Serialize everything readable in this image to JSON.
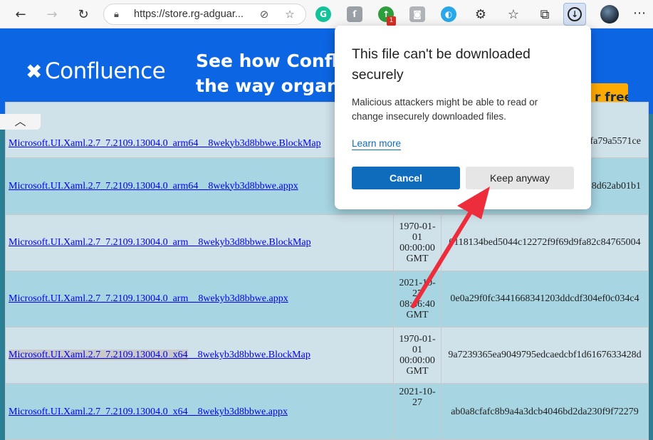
{
  "browser": {
    "url": "https://store.rg-adguar...",
    "back_icon": "arrow-left",
    "forward_icon": "arrow-right",
    "refresh_icon": "refresh",
    "lock_icon": "lock",
    "ext_badge": "1"
  },
  "banner": {
    "logo_text": "Confluence",
    "headline_line1": "See how Conflue",
    "headline_line2": "the way organiza",
    "cta_label": "r free"
  },
  "table": {
    "rows": [
      {
        "file": "Microsoft.UI.Xaml.2.7_7.2109.13004.0_arm64__8wekyb3d8bbwe.BlockMap",
        "date": [
          "",
          "",
          "",
          ""
        ],
        "hash": "fa79a5571ce"
      },
      {
        "file": "Microsoft.UI.Xaml.2.7_7.2109.13004.0_arm64__8wekyb3d8bbwe.appx",
        "date": [
          "",
          "",
          "",
          ""
        ],
        "hash": "8d62ab01b1"
      },
      {
        "file": "Microsoft.UI.Xaml.2.7_7.2109.13004.0_arm__8wekyb3d8bbwe.BlockMap",
        "date": [
          "1970-01-",
          "01",
          "00:00:00",
          "GMT"
        ],
        "hash": "0118134bed5044c12272f9f69d9fa82c84765004"
      },
      {
        "file": "Microsoft.UI.Xaml.2.7_7.2109.13004.0_arm__8wekyb3d8bbwe.appx",
        "date": [
          "2021-10-",
          "27",
          "08:46:40",
          "GMT"
        ],
        "hash": "0e0a29f0fc3441668341203ddcdf304ef0c034c4"
      },
      {
        "file_hl": "Microsoft.UI.Xaml.2.7_7.2109.13004.0_x64",
        "file_rest": "__8wekyb3d8bbwe.BlockMap",
        "date": [
          "1970-01-",
          "01",
          "00:00:00",
          "GMT"
        ],
        "hash": "9a7239365ea9049795edcaedcbf1d6167633428d"
      },
      {
        "file": "Microsoft.UI.Xaml.2.7_7.2109.13004.0_x64__8wekyb3d8bbwe.appx",
        "date": [
          "2021-10-",
          "27",
          "",
          ""
        ],
        "hash": "ab0a8cfafc8b9a4a3dcb4046bd2da230f9f72279"
      }
    ]
  },
  "dialog": {
    "title": "This file can't be downloaded securely",
    "message": "Malicious attackers might be able to read or change insecurely downloaded files.",
    "learn_more": "Learn more",
    "cancel_label": "Cancel",
    "keep_label": "Keep anyway"
  },
  "colors": {
    "banner_bg": "#0c66e4",
    "primary_button": "#0f6cbd",
    "annotation_arrow": "#ee2d3c"
  }
}
